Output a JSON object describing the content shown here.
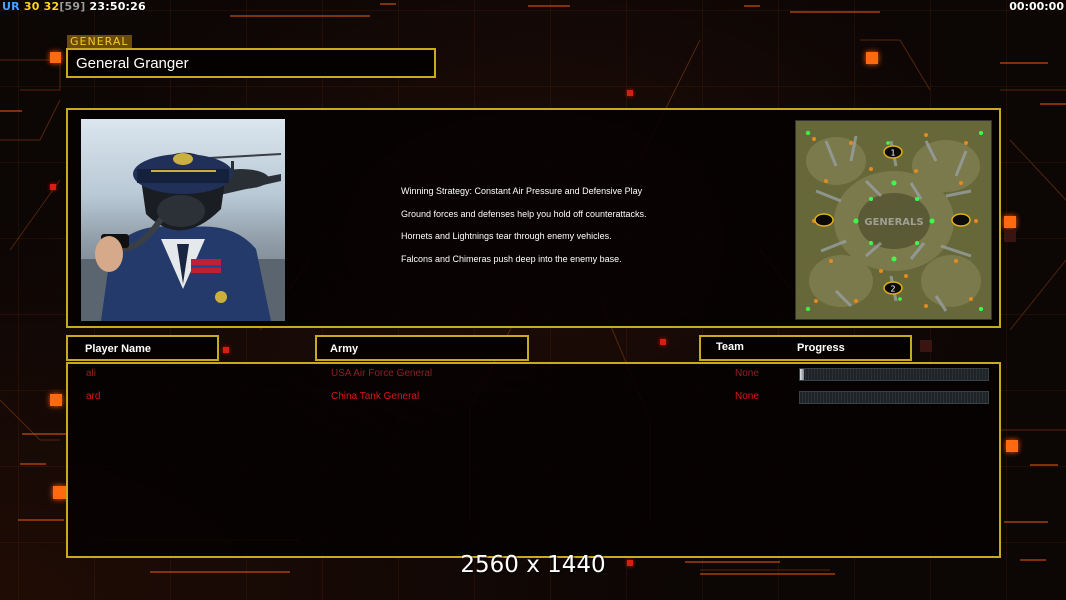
{
  "hud": {
    "ur_a": "UR",
    "ur_b": "30",
    "fps": "32",
    "fps_bracket_open": "[",
    "fps_limit": "59",
    "fps_bracket_close": "]",
    "clock": "23:50:26",
    "game_timer": "00:00:00"
  },
  "general": {
    "tag_label": "GENERAL",
    "name": "General Granger"
  },
  "briefing": {
    "strategy_lines": [
      "Winning Strategy: Constant Air Pressure and Defensive Play",
      "Ground forces and defenses help you hold off counterattacks.",
      "Hornets and Lightnings tear through enemy vehicles.",
      "Falcons and Chimeras push deep into the enemy base."
    ],
    "map_watermark": "GENERALS",
    "map_start_1": "1",
    "map_start_2": "2"
  },
  "table": {
    "headers": {
      "player_name": "Player Name",
      "army": "Army",
      "team": "Team",
      "progress": "Progress"
    },
    "rows": [
      {
        "name": "ali",
        "army": "USA Air Force General",
        "team": "None",
        "progress": 0.02,
        "color": "#8a2222"
      },
      {
        "name": "ard",
        "army": "China Tank General",
        "team": "None",
        "progress": 0,
        "color": "#e01414"
      }
    ]
  },
  "resolution_label": "2560 x 1440",
  "colors": {
    "panel_border": "#c8aa1e",
    "accent_orange": "#ff6a10",
    "general_tag_text": "#f6c82a"
  }
}
